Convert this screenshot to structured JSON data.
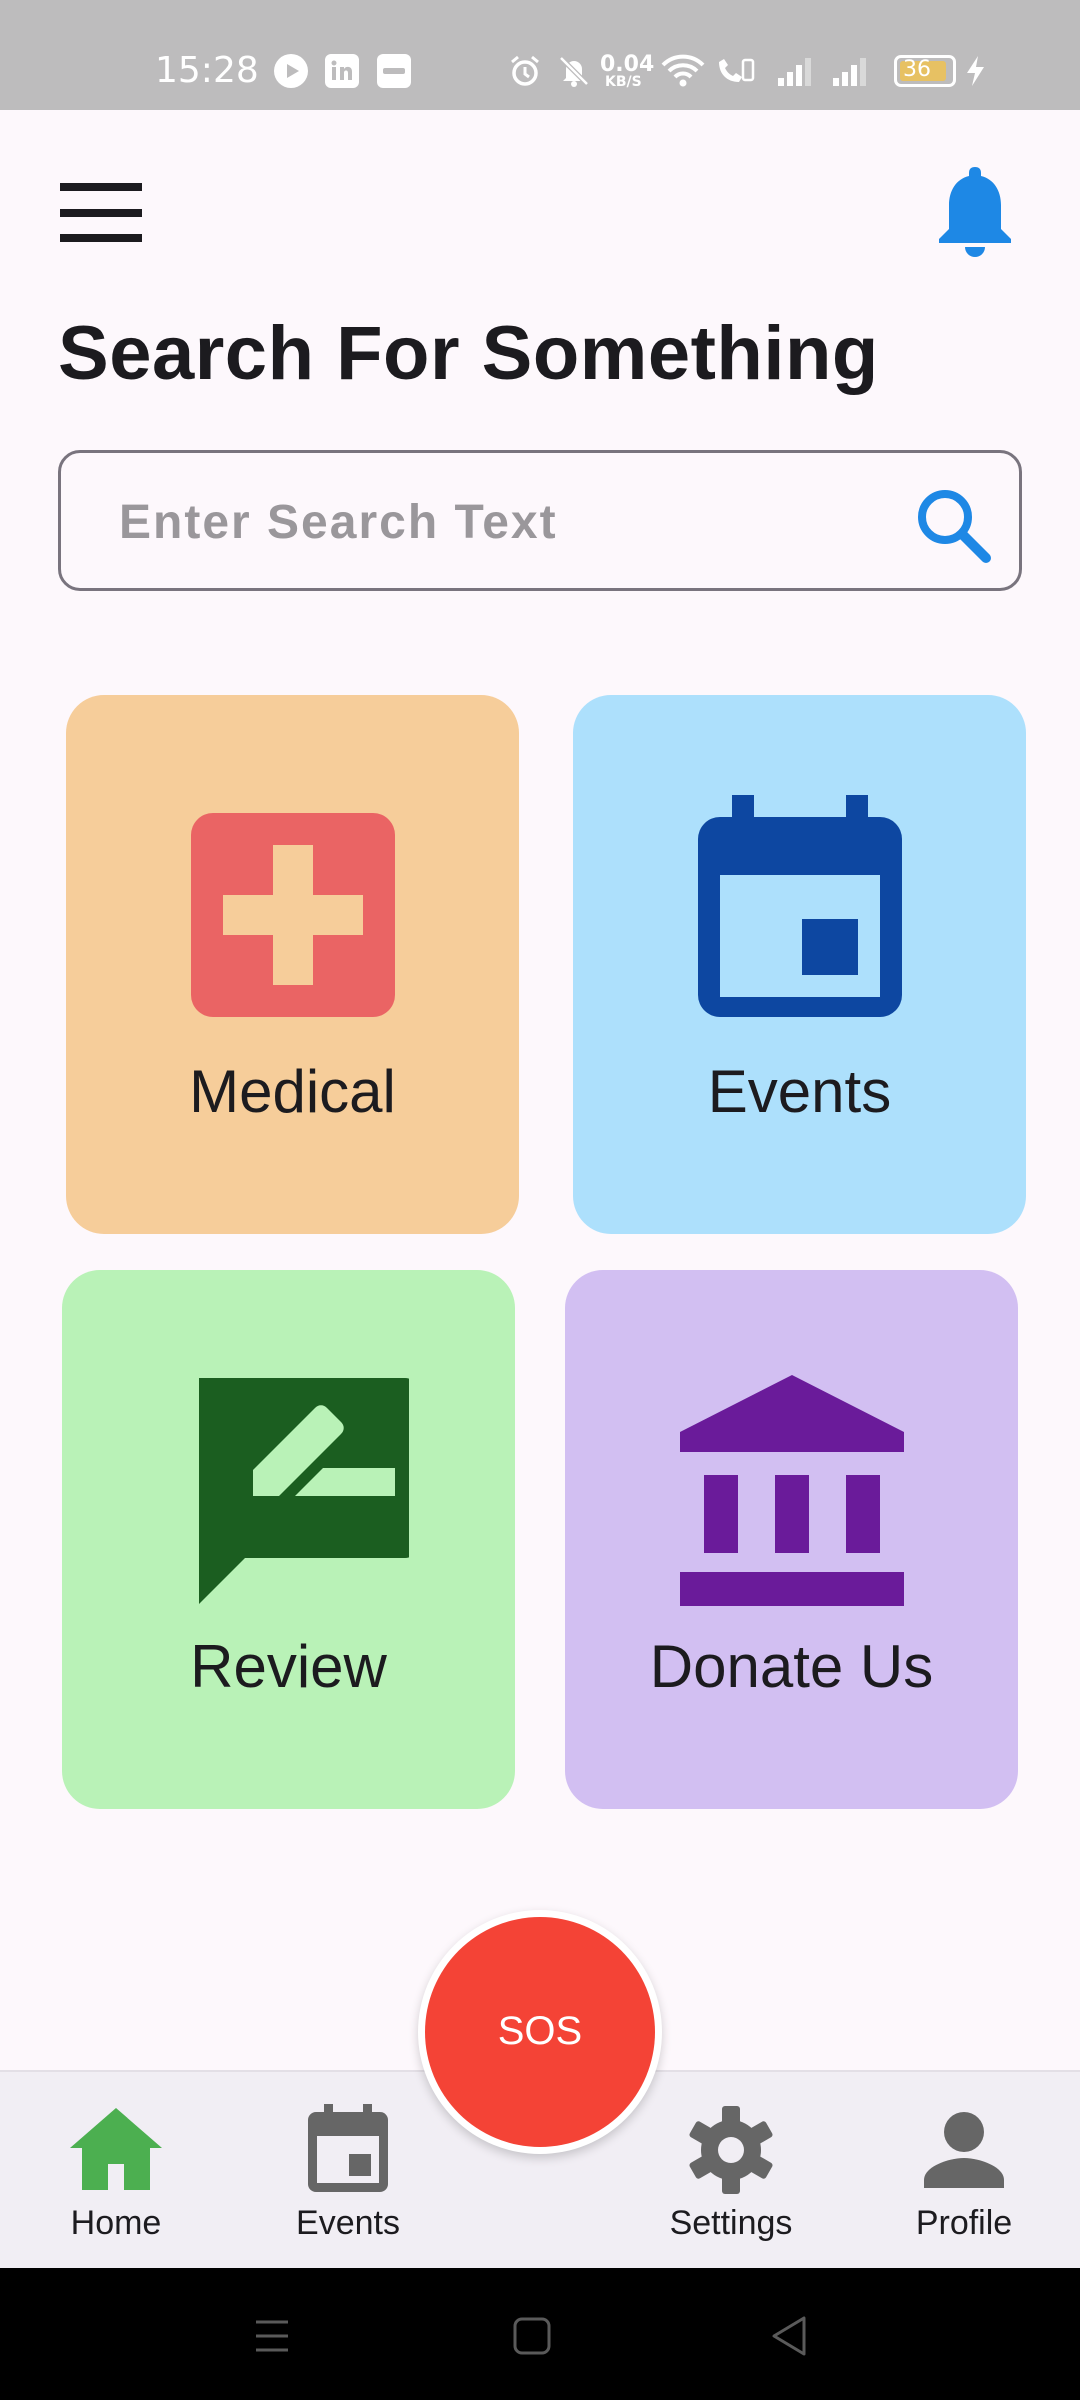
{
  "status_bar": {
    "time": "15:28",
    "network_speed_value": "0.04",
    "network_speed_unit": "KB/S",
    "battery_level": "36",
    "left_icons": [
      "play-icon",
      "linkedin-icon",
      "paytm-icon"
    ],
    "right_icons": [
      "alarm-icon",
      "mute-icon",
      "wifi-icon",
      "volte-icon",
      "signal-icon",
      "signal-icon",
      "battery-icon",
      "charging-icon"
    ]
  },
  "app_bar": {
    "menu_icon": "hamburger-menu-icon",
    "notification_icon": "bell-icon",
    "accent_color": "#1e88e5"
  },
  "page": {
    "title": "Search For Something"
  },
  "search": {
    "placeholder": "Enter Search Text",
    "value": "",
    "icon": "search-icon"
  },
  "categories": [
    {
      "label": "Medical",
      "icon": "medical-cross-icon",
      "bg": "#f6cd9a",
      "icon_color": "#ea6464"
    },
    {
      "label": "Events",
      "icon": "calendar-icon",
      "bg": "#ade0fc",
      "icon_color": "#0d47a1"
    },
    {
      "label": "Review",
      "icon": "rate-review-icon",
      "bg": "#b9f2b7",
      "icon_color": "#1b5e20"
    },
    {
      "label": "Donate Us",
      "icon": "bank-icon",
      "bg": "#d2bff2",
      "icon_color": "#6a1b9a"
    }
  ],
  "sos": {
    "label": "SOS",
    "color": "#f44336"
  },
  "bottom_nav": {
    "items": [
      {
        "label": "Home",
        "icon": "home-icon",
        "active": true,
        "color": "#4caf50"
      },
      {
        "label": "Events",
        "icon": "calendar-icon",
        "active": false,
        "color": "#666666"
      },
      {
        "label": "Settings",
        "icon": "gear-icon",
        "active": false,
        "color": "#666666"
      },
      {
        "label": "Profile",
        "icon": "person-icon",
        "active": false,
        "color": "#666666"
      }
    ]
  },
  "system_nav": {
    "buttons": [
      "recents-icon",
      "home-square-icon",
      "back-triangle-icon"
    ]
  }
}
